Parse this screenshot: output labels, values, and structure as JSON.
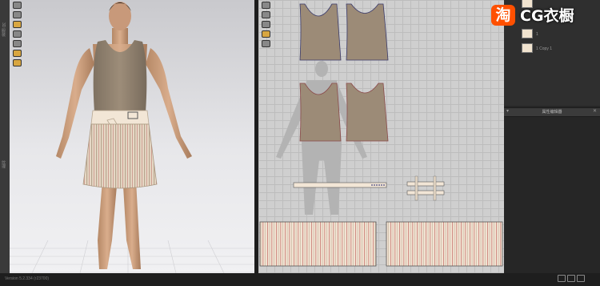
{
  "viewport_3d": {
    "side_labels": [
      "3D 服装",
      "纹理"
    ],
    "tool_icons": [
      "select-icon",
      "move-icon",
      "fold-icon",
      "pin-icon",
      "zoom-icon",
      "texture-icon",
      "avatar-icon"
    ]
  },
  "pattern_2d": {
    "tool_icons": [
      "select-icon",
      "transform-icon",
      "edit-point-icon",
      "pin-icon",
      "avatar-icon"
    ]
  },
  "right_panel": {
    "fabric_items": [
      {
        "label": "",
        "swatch_color": "#f1e3cf"
      },
      {
        "label": "1",
        "swatch_color": "#f1e3cf"
      },
      {
        "label": "1 Copy 1",
        "swatch_color": "#f1e3cf"
      }
    ],
    "property_editor_title": "属性编辑器",
    "collapse_arrow": "▾",
    "close_glyph": "✕"
  },
  "status_bar": {
    "text": "Version 5.2.334 (r23700)"
  },
  "watermark": {
    "logo_glyph": "淘",
    "text": "CG衣橱",
    "logo_color": "#ff5000"
  },
  "colors": {
    "top_fabric": "#9a8a77",
    "skirt_fabric": "#f0e0d0",
    "skirt_stripe": "#c26a63"
  }
}
